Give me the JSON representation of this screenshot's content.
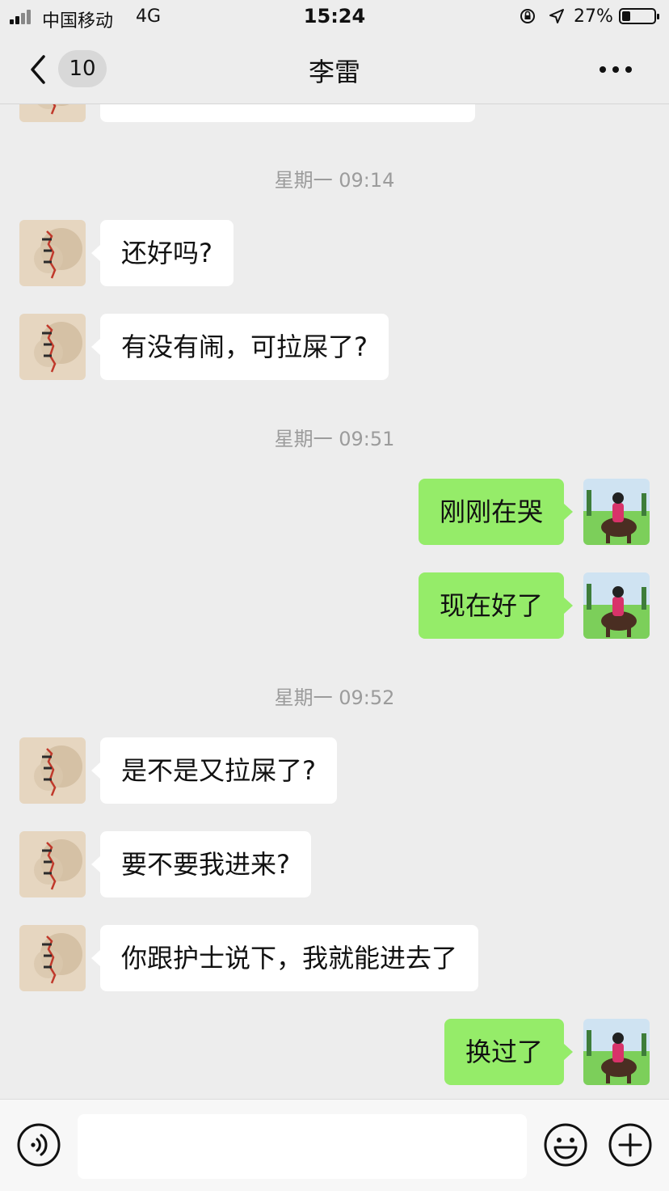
{
  "status_bar": {
    "carrier": "中国移动",
    "network": "4G",
    "time": "15:24",
    "battery_percent": "27%",
    "battery_level": 0.27
  },
  "nav": {
    "unread_count": "10",
    "title": "李雷",
    "icons": {
      "back": "chevron-left-icon",
      "more": "more-dots-icon"
    }
  },
  "messages": [
    {
      "side": "in",
      "text": ""
    },
    {
      "type": "timestamp",
      "text": "星期一 09:14"
    },
    {
      "side": "in",
      "text": "还好吗?"
    },
    {
      "side": "in",
      "text": "有没有闹，可拉屎了?"
    },
    {
      "type": "timestamp",
      "text": "星期一 09:51"
    },
    {
      "side": "out",
      "text": "刚刚在哭"
    },
    {
      "side": "out",
      "text": "现在好了"
    },
    {
      "type": "timestamp",
      "text": "星期一 09:52"
    },
    {
      "side": "in",
      "text": "是不是又拉屎了?"
    },
    {
      "side": "in",
      "text": "要不要我进来?"
    },
    {
      "side": "in",
      "text": "你跟护士说下，我就能进去了"
    },
    {
      "side": "out",
      "text": "换过了"
    }
  ],
  "input_bar": {
    "text": "",
    "icons": {
      "voice": "voice-icon",
      "emoji": "emoji-icon",
      "add": "plus-icon"
    }
  },
  "colors": {
    "background": "#ededed",
    "incoming_bubble": "#ffffff",
    "outgoing_bubble": "#95ec69",
    "timestamp_text": "#9c9c9c"
  }
}
